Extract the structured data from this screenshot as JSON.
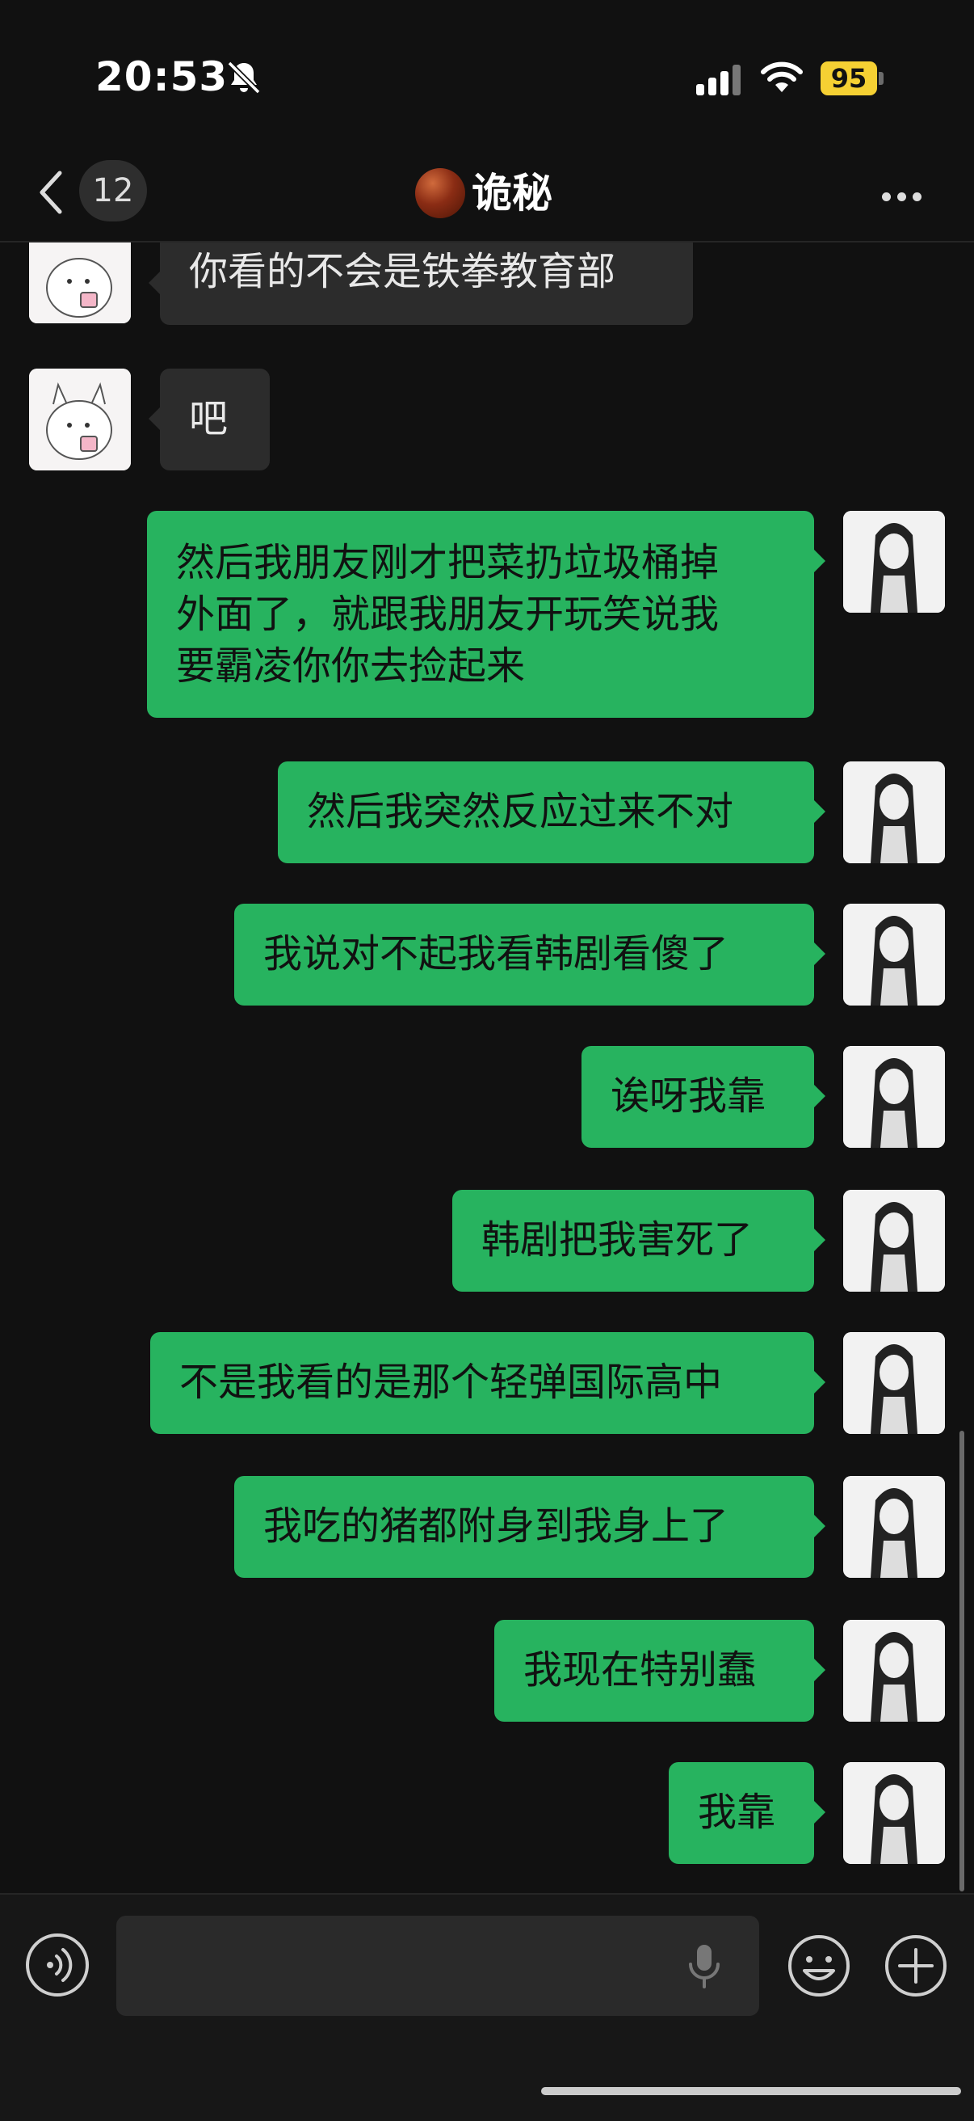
{
  "status_bar": {
    "time": "20:53",
    "battery": "95"
  },
  "header": {
    "back_count": "12",
    "title": "诡秘"
  },
  "messages": [
    {
      "side": "in",
      "text": "你看的不会是铁拳教育部"
    },
    {
      "side": "in",
      "text": "吧"
    },
    {
      "side": "out",
      "text": "然后我朋友刚才把菜扔垃圾桶掉\n外面了，就跟我朋友开玩笑说我\n要霸凌你你去捡起来"
    },
    {
      "side": "out",
      "text": "然后我突然反应过来不对"
    },
    {
      "side": "out",
      "text": "我说对不起我看韩剧看傻了"
    },
    {
      "side": "out",
      "text": "诶呀我靠"
    },
    {
      "side": "out",
      "text": "韩剧把我害死了"
    },
    {
      "side": "out",
      "text": "不是我看的是那个轻弹国际高中"
    },
    {
      "side": "out",
      "text": "我吃的猪都附身到我身上了"
    },
    {
      "side": "out",
      "text": "我现在特别蠢"
    },
    {
      "side": "out",
      "text": "我靠"
    }
  ],
  "input": {
    "placeholder": ""
  },
  "icons": {
    "muted": "bell-slash-icon",
    "signal": "cellular-signal-icon",
    "wifi": "wifi-icon",
    "back": "chevron-left-icon",
    "more": "more-dots-icon",
    "voice": "voice-mode-icon",
    "mic": "microphone-icon",
    "emoji": "emoji-icon",
    "plus": "plus-icon"
  },
  "colors": {
    "background": "#111111",
    "outgoing_bubble": "#27b35f",
    "incoming_bubble": "#2c2c2c",
    "battery": "#f5d033"
  }
}
